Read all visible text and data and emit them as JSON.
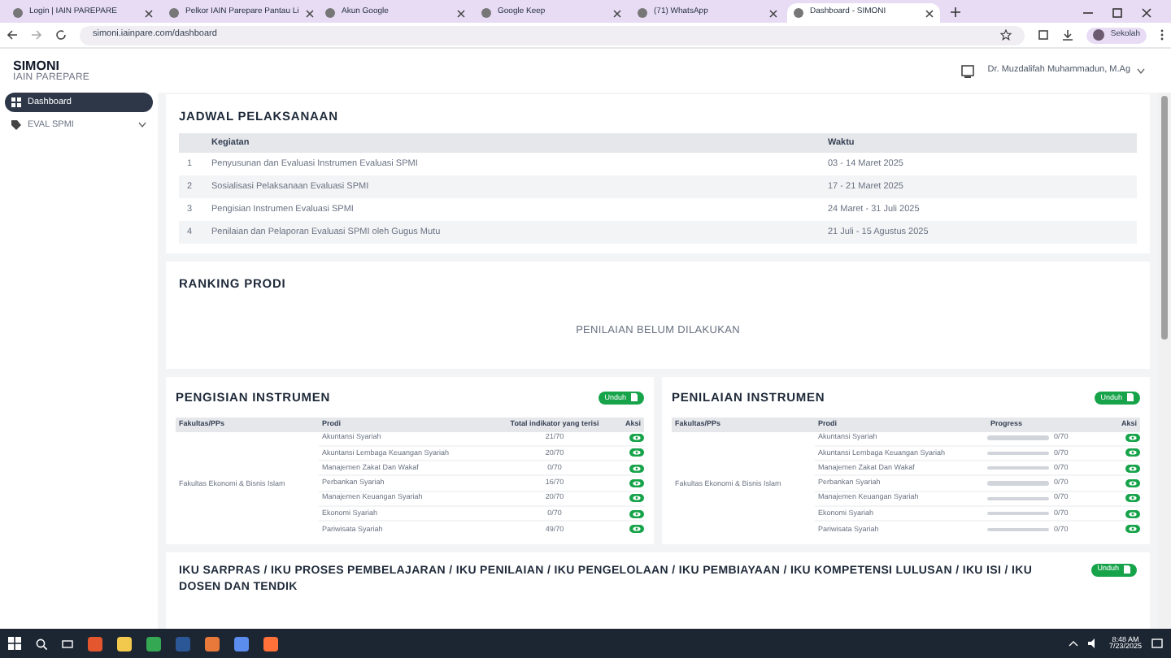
{
  "browser": {
    "tabs": [
      {
        "label": "Login | IAIN PAREPARE",
        "selected": false
      },
      {
        "label": "Pelkor IAIN Parepare Pantau Li",
        "selected": false
      },
      {
        "label": "Akun Google",
        "selected": false
      },
      {
        "label": "Google Keep",
        "selected": false
      },
      {
        "label": "(71) WhatsApp",
        "selected": false
      },
      {
        "label": "Dashboard - SIMONI",
        "selected": true
      }
    ],
    "url": "simoni.iainpare.com/dashboard",
    "profile": "Sekolah"
  },
  "header": {
    "brand": "SIMONI",
    "subtitle": "IAIN PAREPARE",
    "user": "Dr. Muzdalifah Muhammadun, M.Ag"
  },
  "sidebar": {
    "items": [
      {
        "label": "Dashboard",
        "selected": true,
        "has_children": false
      },
      {
        "label": "EVAL SPMI",
        "selected": false,
        "has_children": true
      }
    ]
  },
  "jadwal": {
    "title": "JADWAL PELAKSANAAN",
    "columns": [
      "Kegiatan",
      "Waktu"
    ],
    "rows": [
      {
        "no": "1",
        "kegiatan": "Penyusunan dan Evaluasi Instrumen Evaluasi SPMI",
        "waktu": "03 - 14 Maret 2025"
      },
      {
        "no": "2",
        "kegiatan": "Sosialisasi Pelaksanaan Evaluasi SPMI",
        "waktu": "17 - 21 Maret 2025"
      },
      {
        "no": "3",
        "kegiatan": "Pengisian Instrumen Evaluasi SPMI",
        "waktu": "24 Maret - 31 Juli 2025"
      },
      {
        "no": "4",
        "kegiatan": "Penilaian dan Pelaporan Evaluasi SPMI oleh Gugus Mutu",
        "waktu": "21 Juli - 15 Agustus 2025"
      }
    ]
  },
  "ranking": {
    "title": "RANKING PRODI",
    "message": "PENILAIAN BELUM DILAKUKAN"
  },
  "pengisian": {
    "title": "PENGISIAN INSTRUMEN",
    "button": "Unduh",
    "columns": [
      "Fakultas/PPs",
      "Prodi",
      "Total indikator yang terisi",
      "Aksi"
    ],
    "fakultas": "Fakultas Ekonomi & Bisnis Islam",
    "rows": [
      {
        "prodi": "Akuntansi Syariah",
        "total": "21/70"
      },
      {
        "prodi": "Akuntansi Lembaga Keuangan Syariah",
        "total": "20/70"
      },
      {
        "prodi": "Manajemen Zakat Dan Wakaf",
        "total": "0/70"
      },
      {
        "prodi": "Perbankan Syariah",
        "total": "16/70"
      },
      {
        "prodi": "Manajemen Keuangan Syariah",
        "total": "20/70"
      },
      {
        "prodi": "Ekonomi Syariah",
        "total": "0/70"
      },
      {
        "prodi": "Pariwisata Syariah",
        "total": "49/70"
      }
    ]
  },
  "penilaian": {
    "title": "PENILAIAN INSTRUMEN",
    "button": "Unduh",
    "columns": [
      "Fakultas/PPs",
      "Prodi",
      "Progress",
      "Aksi"
    ],
    "fakultas": "Fakultas Ekonomi & Bisnis Islam",
    "rows": [
      {
        "prodi": "Akuntansi Syariah",
        "level": 0,
        "progress": "0/70"
      },
      {
        "prodi": "Akuntansi Lembaga Keuangan Syariah",
        "level": 0,
        "progress": "0/70"
      },
      {
        "prodi": "Manajemen Zakat Dan Wakaf",
        "level": 0,
        "progress": "0/70"
      },
      {
        "prodi": "Perbankan Syariah",
        "level": 0,
        "progress": "0/70"
      },
      {
        "prodi": "Manajemen Keuangan Syariah",
        "level": 0,
        "progress": "0/70"
      },
      {
        "prodi": "Ekonomi Syariah",
        "level": 0,
        "progress": "0/70"
      },
      {
        "prodi": "Pariwisata Syariah",
        "level": 0,
        "progress": "0/70"
      }
    ]
  },
  "iku": {
    "title": "IKU SARPRAS / IKU PROSES PEMBELAJARAN / IKU PENILAIAN / IKU PENGELOLAAN / IKU PEMBIAYAAN / IKU KOMPETENSI LULUSAN / IKU ISI / IKU DOSEN DAN TENDIK",
    "button": "Unduh"
  },
  "taskbar": {
    "time": "8:48 AM",
    "date": "7/23/2025"
  }
}
